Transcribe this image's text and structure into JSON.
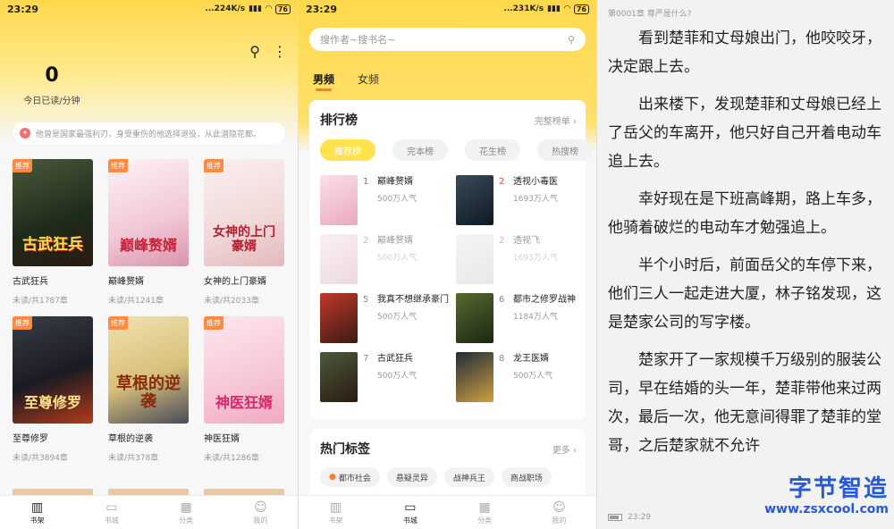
{
  "status_bars": [
    {
      "time": "23:29",
      "speed": "...224K/s",
      "battery": "76"
    },
    {
      "time": "23:29",
      "speed": "...231K/s",
      "battery": "76"
    }
  ],
  "shelf": {
    "count": "0",
    "count_label": "今日已读/分钟",
    "notice": "他曾是国家最强利刃，身受重伤的他选择退役，从此潜隐花都。",
    "books": [
      {
        "title": "古武狂兵",
        "meta": "未读/共1787章",
        "cover_text": "古武狂兵",
        "tag": "推荐"
      },
      {
        "title": "巅峰赘婿",
        "meta": "未读/共1241章",
        "cover_text": "巅峰赘婿",
        "tag": "推荐"
      },
      {
        "title": "女神的上门豪婿",
        "meta": "未读/共2033章",
        "cover_text": "女神的上门豪婿",
        "tag": "推荐"
      },
      {
        "title": "至尊修罗",
        "meta": "未读/共3894章",
        "cover_text": "至尊修罗",
        "tag": "推荐"
      },
      {
        "title": "草根的逆袭",
        "meta": "未读/共378章",
        "cover_text": "草根的逆袭",
        "tag": "推荐"
      },
      {
        "title": "神医狂婿",
        "meta": "未读/共1286章",
        "cover_text": "神医狂婿",
        "tag": "推荐"
      }
    ]
  },
  "tabbar": [
    {
      "label": "书架",
      "icon": "bookshelf-icon"
    },
    {
      "label": "书城",
      "icon": "bookstore-icon"
    },
    {
      "label": "分类",
      "icon": "category-icon"
    },
    {
      "label": "我的",
      "icon": "profile-icon"
    }
  ],
  "store": {
    "search_placeholder": "搜作者~搜书名~",
    "gender_tabs": [
      "男频",
      "女频"
    ],
    "rank": {
      "title": "排行榜",
      "more": "完整榜单 ›",
      "tabs": [
        "推荐榜",
        "完本榜",
        "花生榜",
        "热搜榜"
      ],
      "items": [
        {
          "num": "1",
          "name": "巅峰赘婿",
          "pop": "500万人气"
        },
        {
          "num": "2",
          "name": "透视小毒医",
          "pop": "1693万人气"
        },
        {
          "num": "2",
          "name": "巅峰赘婿",
          "pop": "500万人气"
        },
        {
          "num": "2",
          "name": "透视飞",
          "pop": "1693万人气"
        },
        {
          "num": "5",
          "name": "我真不想继承豪门",
          "pop": "500万人气"
        },
        {
          "num": "6",
          "name": "都市之修罗战神",
          "pop": "1184万人气"
        },
        {
          "num": "7",
          "name": "古武狂兵",
          "pop": "500万人气"
        },
        {
          "num": "8",
          "name": "龙王医婿",
          "pop": "500万人气"
        }
      ]
    },
    "hot": {
      "title": "热门标签",
      "more": "更多 ›",
      "tags": [
        "都市社会",
        "悬疑灵异",
        "战神兵王",
        "商战职场"
      ]
    }
  },
  "reader": {
    "chapter": "第0001章 尊严是什么?",
    "paragraphs": [
      "看到楚菲和丈母娘出门，他咬咬牙，决定跟上去。",
      "出来楼下，发现楚菲和丈母娘已经上了岳父的车离开，他只好自己开着电动车追上去。",
      "幸好现在是下班高峰期，路上车多，他骑着破烂的电动车才勉强追上。",
      "半个小时后，前面岳父的车停下来，他们三人一起走进大厦，林子铭发现，这是楚家公司的写字楼。",
      "楚家开了一家规模千万级别的服装公司，早在结婚的头一年，楚菲带他来过两次，最后一次，他无意间得罪了楚菲的堂哥，之后楚家就不允许"
    ],
    "time": "23:29",
    "watermark_top": "字节智造",
    "watermark_bottom": "www.zsxcool.com"
  }
}
